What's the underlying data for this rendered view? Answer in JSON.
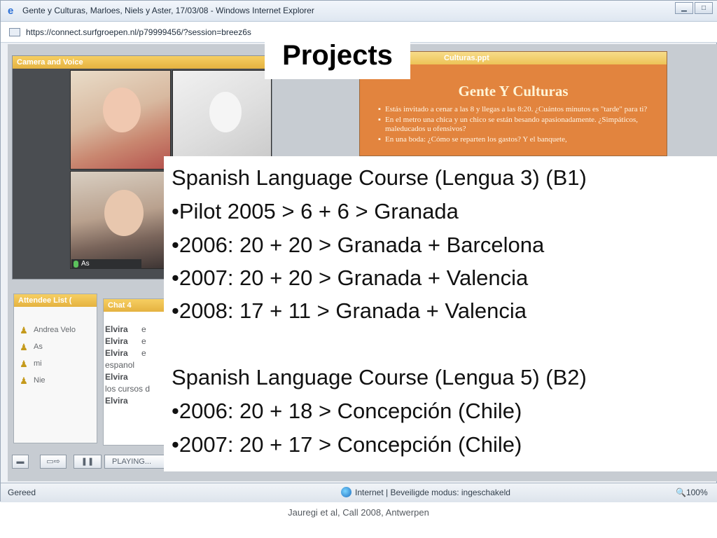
{
  "window": {
    "title": "Gente y Culturas, Marloes, Niels y Aster, 17/03/08 - Windows Internet Explorer",
    "url": "https://connect.surfgroepen.nl/p79999456/?session=breez6s",
    "minimize_icon": "minimize-icon",
    "maximize_icon": "maximize-icon"
  },
  "meeting": {
    "camera_panel_title": "Camera and Voice",
    "camera_label": "As",
    "slide_panel_title": "Culturas.ppt",
    "slide": {
      "title": "Gente Y Culturas",
      "bullets": [
        "Estás invitado a cenar a las 8 y llegas a las 8:20. ¿Cuántos minutos es \"tarde\" para ti?",
        "En el metro una chica y un chico se están besando apasionadamente. ¿Simpáticos, maleducados u ofensivos?",
        "En una boda: ¿Cómo se reparten los gastos? Y el banquete,"
      ]
    },
    "attendee_panel_title": "Attendee List (",
    "attendees": [
      "Andrea Velo",
      "As",
      "mi",
      "Nie"
    ],
    "chat_panel_title": "Chat 4",
    "chat_lines": [
      {
        "name": "Elvira",
        "text": "e"
      },
      {
        "name": "Elvira",
        "text": "e"
      },
      {
        "name": "Elvira",
        "text": "e"
      },
      {
        "name": "",
        "text": "espanol"
      },
      {
        "name": "Elvira",
        "text": ""
      },
      {
        "name": "",
        "text": " los cursos d"
      },
      {
        "name": "Elvira",
        "text": ""
      }
    ],
    "playing_label": "PLAYING..."
  },
  "overlay": {
    "heading": "Projects",
    "lines": [
      "Spanish Language Course (Lengua 3) (B1)",
      "•Pilot 2005 > 6 + 6  > Granada",
      "•2006: 20 + 20 > Granada + Barcelona",
      "•2007: 20 + 20 > Granada + Valencia",
      "•2008: 17 + 11 > Granada + Valencia",
      "Spanish Language Course (Lengua 5) (B2)",
      "•2006: 20 + 18 > Concepción (Chile)",
      "•2007: 20 + 17 >  Concepción (Chile)"
    ]
  },
  "statusbar": {
    "status": "Gereed",
    "zone": "Internet | Beveiligde modus: ingeschakeld",
    "zoom": "100%"
  },
  "caption": "Jauregi et al, Call 2008, Antwerpen",
  "colors": {
    "panel_header": "#e5b240",
    "slide_background": "#e2843e",
    "overlay_background": "#ffffff"
  }
}
